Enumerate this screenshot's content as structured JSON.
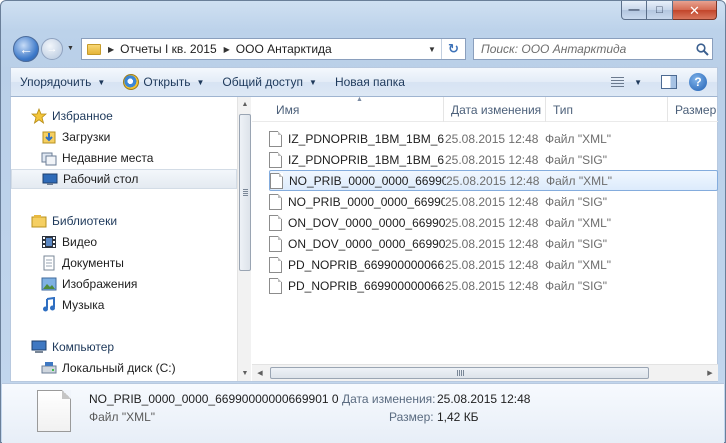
{
  "window": {
    "caption": {
      "minimize": "—",
      "maximize": "□",
      "close": "✕"
    }
  },
  "address": {
    "crumbs": [
      "Отчеты I кв. 2015",
      "ООО Антарктида"
    ]
  },
  "search": {
    "placeholder": "Поиск: ООО Антарктида"
  },
  "toolbar": {
    "organize": "Упорядочить",
    "open": "Открыть",
    "share": "Общий доступ",
    "new_folder": "Новая папка"
  },
  "sidebar": {
    "items": [
      {
        "label": "Избранное",
        "icon": "star-icon",
        "group": true
      },
      {
        "label": "Загрузки",
        "icon": "downloads-icon"
      },
      {
        "label": "Недавние места",
        "icon": "recent-places-icon"
      },
      {
        "label": "Рабочий стол",
        "icon": "desktop-icon",
        "selected": true
      },
      {
        "label": "Библиотеки",
        "icon": "libraries-icon",
        "group": true
      },
      {
        "label": "Видео",
        "icon": "video-icon"
      },
      {
        "label": "Документы",
        "icon": "documents-icon"
      },
      {
        "label": "Изображения",
        "icon": "pictures-icon"
      },
      {
        "label": "Музыка",
        "icon": "music-icon"
      },
      {
        "label": "Компьютер",
        "icon": "computer-icon",
        "group": true
      },
      {
        "label": "Локальный диск (C:)",
        "icon": "disk-icon"
      }
    ]
  },
  "columns": {
    "name": "Имя",
    "date": "Дата изменения",
    "type": "Тип",
    "size": "Размер"
  },
  "files": [
    {
      "name": "IZ_PDNOPRIB_1BM_1BM_6...",
      "date": "25.08.2015 12:48",
      "type": "Файл \"XML\""
    },
    {
      "name": "IZ_PDNOPRIB_1BM_1BM_6...",
      "date": "25.08.2015 12:48",
      "type": "Файл \"SIG\""
    },
    {
      "name": "NO_PRIB_0000_0000_66990...",
      "date": "25.08.2015 12:48",
      "type": "Файл \"XML\"",
      "selected": true
    },
    {
      "name": "NO_PRIB_0000_0000_66990...",
      "date": "25.08.2015 12:48",
      "type": "Файл \"SIG\""
    },
    {
      "name": "ON_DOV_0000_0000_66990...",
      "date": "25.08.2015 12:48",
      "type": "Файл \"XML\""
    },
    {
      "name": "ON_DOV_0000_0000_66990...",
      "date": "25.08.2015 12:48",
      "type": "Файл \"SIG\""
    },
    {
      "name": "PD_NOPRIB_669900000066...",
      "date": "25.08.2015 12:48",
      "type": "Файл \"XML\""
    },
    {
      "name": "PD_NOPRIB_669900000066...",
      "date": "25.08.2015 12:48",
      "type": "Файл \"SIG\""
    }
  ],
  "details": {
    "name": "NO_PRIB_0000_0000_66990000000669901 0...",
    "type": "Файл \"XML\"",
    "modified_label": "Дата изменения:",
    "modified_value": "25.08.2015 12:48",
    "size_label": "Размер:",
    "size_value": "1,42 КБ"
  }
}
